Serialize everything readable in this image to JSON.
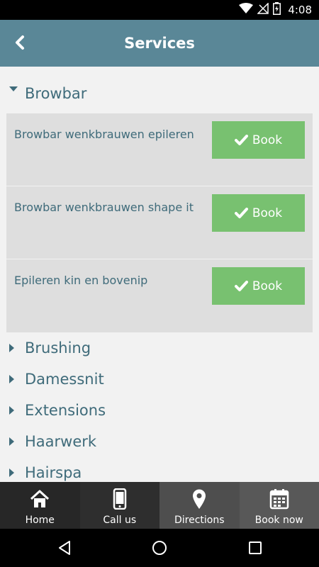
{
  "status_bar": {
    "time": "4:08"
  },
  "header": {
    "title": "Services"
  },
  "categories_open": {
    "label": "Browbar"
  },
  "services": [
    {
      "name": "Browbar wenkbrauwen epileren",
      "button": "Book"
    },
    {
      "name": "Browbar wenkbrauwen shape it",
      "button": "Book"
    },
    {
      "name": "Epileren kin en bovenip",
      "button": "Book"
    }
  ],
  "categories_closed": [
    {
      "label": "Brushing"
    },
    {
      "label": "Damessnit"
    },
    {
      "label": "Extensions"
    },
    {
      "label": "Haarwerk"
    },
    {
      "label": "Hairspa"
    }
  ],
  "bottom_nav": [
    {
      "label": "Home",
      "icon": "home-icon"
    },
    {
      "label": "Call us",
      "icon": "phone-icon"
    },
    {
      "label": "Directions",
      "icon": "map-pin-icon"
    },
    {
      "label": "Book now",
      "icon": "calendar-icon"
    }
  ],
  "colors": {
    "header": "#5a8797",
    "accent_text": "#3f6b7a",
    "book_button": "#78c170",
    "service_bg": "#dedede"
  }
}
